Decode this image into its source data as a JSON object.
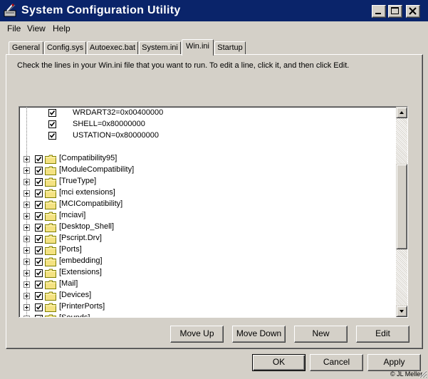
{
  "window": {
    "title": "System Configuration Utility"
  },
  "menu": [
    {
      "label": "File"
    },
    {
      "label": "View"
    },
    {
      "label": "Help"
    }
  ],
  "tabs": [
    {
      "label": "General"
    },
    {
      "label": "Config.sys"
    },
    {
      "label": "Autoexec.bat"
    },
    {
      "label": "System.ini"
    },
    {
      "label": "Win.ini",
      "active": true
    },
    {
      "label": "Startup"
    }
  ],
  "instructions": "Check the lines in your Win.ini file that you want to run. To edit a line, click it, and then click Edit.",
  "list": {
    "lines": [
      {
        "text": "WRDART32=0x00400000",
        "checked": true
      },
      {
        "text": "SHELL=0x80000000",
        "checked": true
      },
      {
        "text": "USTATION=0x80000000",
        "checked": true
      }
    ],
    "sections": [
      {
        "text": "[Compatibility95]",
        "checked": true
      },
      {
        "text": "[ModuleCompatibility]",
        "checked": true
      },
      {
        "text": "[TrueType]",
        "checked": true
      },
      {
        "text": "[mci extensions]",
        "checked": true
      },
      {
        "text": "[MCICompatibility]",
        "checked": true
      },
      {
        "text": "[mciavi]",
        "checked": true
      },
      {
        "text": "[Desktop_Shell]",
        "checked": true
      },
      {
        "text": "[Pscript.Drv]",
        "checked": true
      },
      {
        "text": "[Ports]",
        "checked": true
      },
      {
        "text": "[embedding]",
        "checked": true
      },
      {
        "text": "[Extensions]",
        "checked": true
      },
      {
        "text": "[Mail]",
        "checked": true
      },
      {
        "text": "[Devices]",
        "checked": true
      },
      {
        "text": "[PrinterPorts]",
        "checked": true
      },
      {
        "text": "[Sounds]",
        "checked": true
      }
    ],
    "scroll_position": 0.45
  },
  "edit_buttons": {
    "move_up": "Move Up",
    "move_down": "Move Down",
    "new": "New",
    "edit": "Edit"
  },
  "dialog_buttons": {
    "ok": "OK",
    "cancel": "Cancel",
    "apply": "Apply"
  },
  "copyright": "© JL Meller",
  "colors": {
    "titlebar": "#0a246a",
    "face": "#d4d0c8",
    "folder": "#f4e282"
  }
}
